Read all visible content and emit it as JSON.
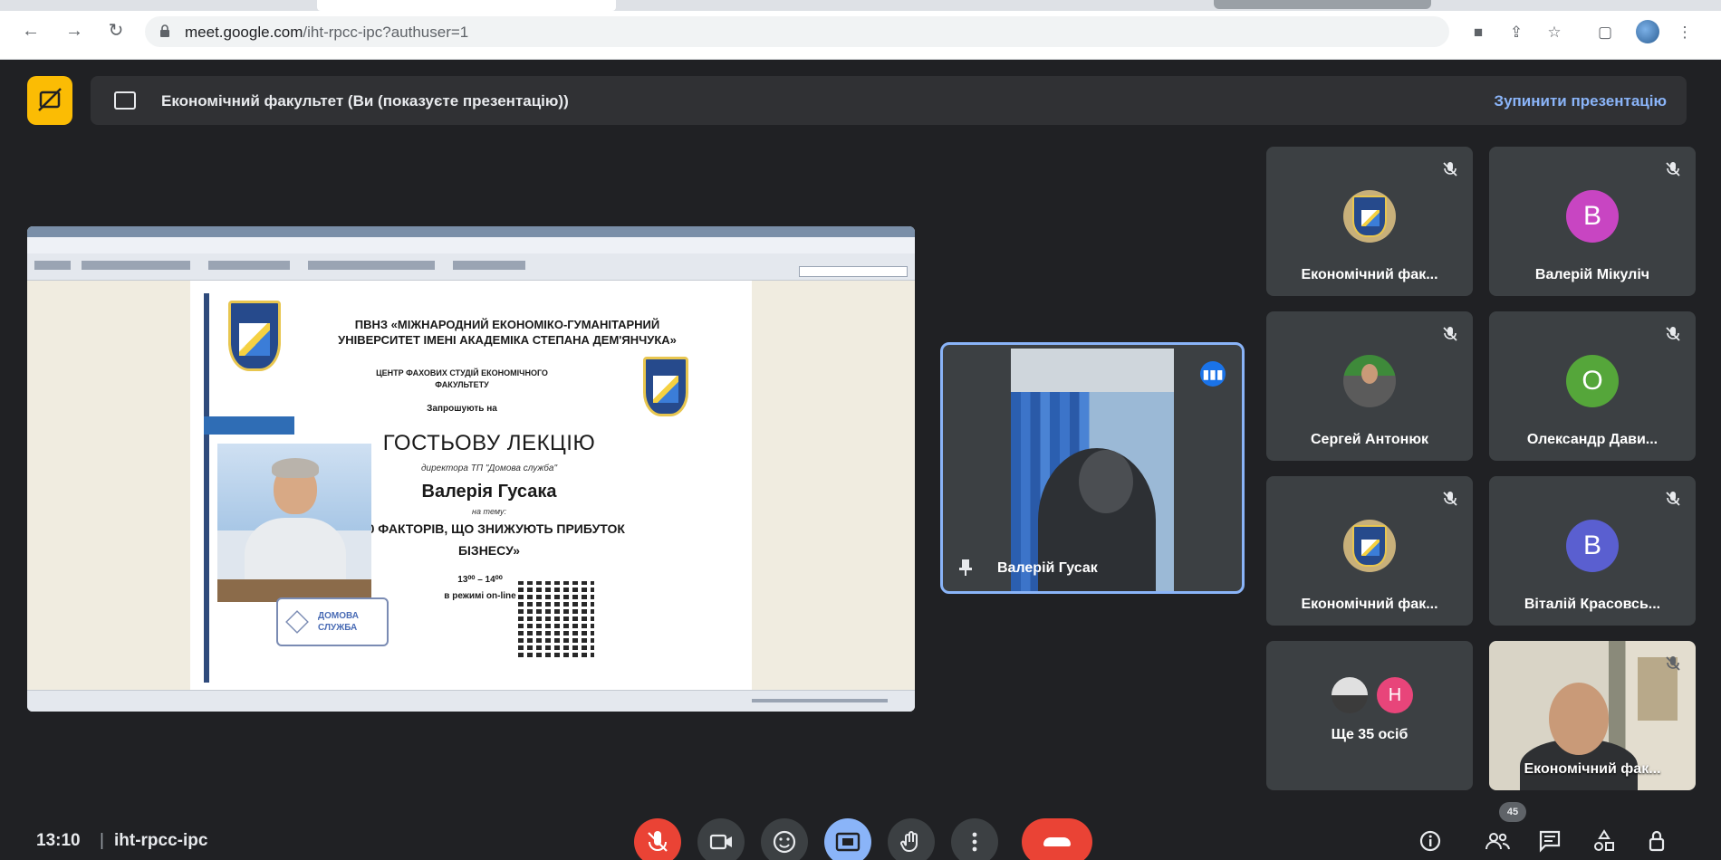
{
  "browser": {
    "url_host": "meet.google.com",
    "url_path": "/iht-rpcc-ipc?authuser=1"
  },
  "presenting_bar": {
    "title": "Економічний факультет (Ви (показуєте презентацію))",
    "stop_label": "Зупинити презентацію"
  },
  "slide": {
    "org": "ПВНЗ «МІЖНАРОДНИЙ ЕКОНОМІКО-ГУМАНІТАРНИЙ УНІВЕРСИТЕТ ІМЕНІ АКАДЕМІКА СТЕПАНА ДЕМ'ЯНЧУКА»",
    "center": "ЦЕНТР ФАХОВИХ СТУДІЙ ЕКОНОМІЧНОГО ФАКУЛЬТЕТУ",
    "invites": "Запрошують на",
    "lecture": "ГОСТЬОВУ ЛЕКЦІЮ",
    "director": "директора ТП \"Домова служба\"",
    "speaker": "Валерія Гусака",
    "on_topic": "на тему:",
    "topic": "«10 ФАКТОРІВ, ЩО ЗНИЖУЮТЬ ПРИБУТОК БІЗНЕСУ»",
    "time": "13⁰⁰ – 14⁰⁰",
    "mode": "в режимі on-line",
    "logo_text": "ДОМОВА СЛУЖБА"
  },
  "pinned_video": {
    "name": "Валерій Гусак"
  },
  "participants": [
    {
      "name": "Економічний фак...",
      "avatar": "crest"
    },
    {
      "name": "Валерій Мікуліч",
      "avatar": "letter",
      "letter": "В",
      "color": "#c845c2"
    },
    {
      "name": "Сергей Антонюк",
      "avatar": "photo"
    },
    {
      "name": "Олександр Дави...",
      "avatar": "letter",
      "letter": "О",
      "color": "#55a63a"
    },
    {
      "name": "Економічний фак...",
      "avatar": "crest"
    },
    {
      "name": "Віталій Красовсь...",
      "avatar": "letter",
      "letter": "В",
      "color": "#5a5fd0"
    }
  ],
  "more_tile": {
    "label": "Ще 35 осіб",
    "letter": "Н",
    "color": "#e8457a"
  },
  "self_video": {
    "name": "Економічний фак..."
  },
  "bottom": {
    "time": "13:10",
    "separator": "|",
    "meeting_code": "iht-rpcc-ipc",
    "participant_count": "45"
  },
  "colors": {
    "background": "#202124",
    "accent_blue": "#8ab4f8",
    "danger_red": "#ea4335",
    "present_yellow": "#fbbc04"
  }
}
